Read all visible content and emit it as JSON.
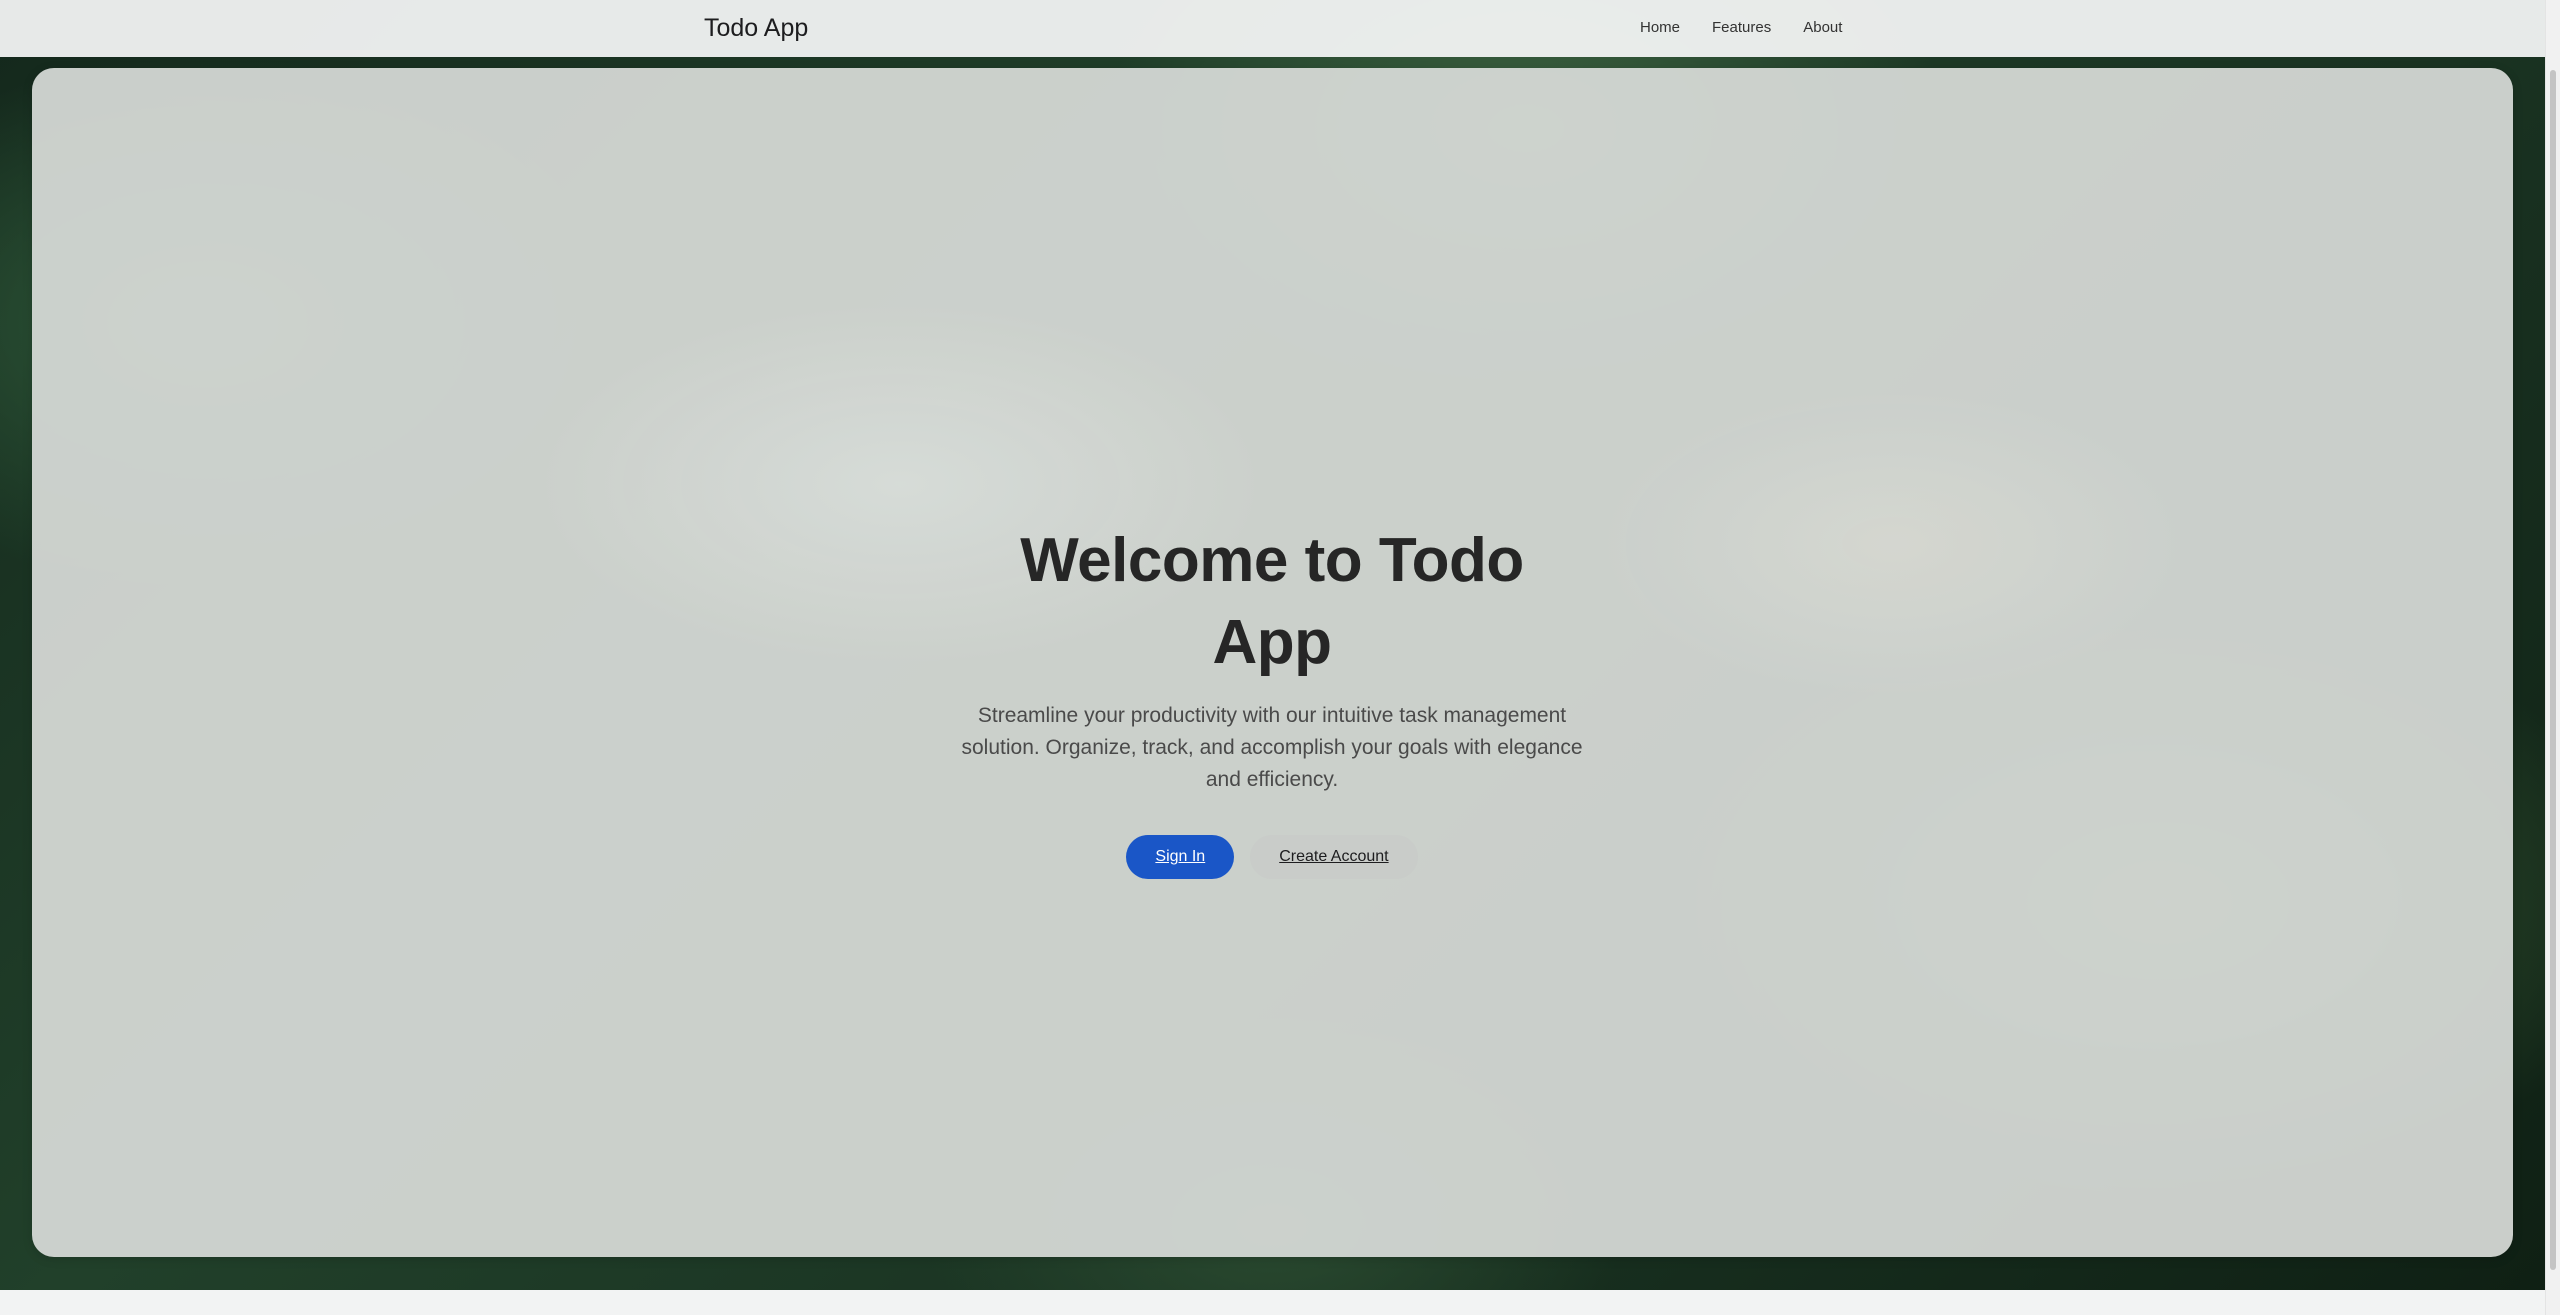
{
  "header": {
    "brand": "Todo App",
    "nav": [
      {
        "label": "Home"
      },
      {
        "label": "Features"
      },
      {
        "label": "About"
      }
    ]
  },
  "hero": {
    "title": "Welcome to Todo App",
    "subtitle": "Streamline your productivity with our intuitive task management solution. Organize, track, and accomplish your goals with elegance and efficiency.",
    "primary_button": "Sign In",
    "secondary_button": "Create Account"
  },
  "colors": {
    "primary": "#1a56c7",
    "secondary_button_bg": "#c8cbc8",
    "title_text": "#262626"
  }
}
